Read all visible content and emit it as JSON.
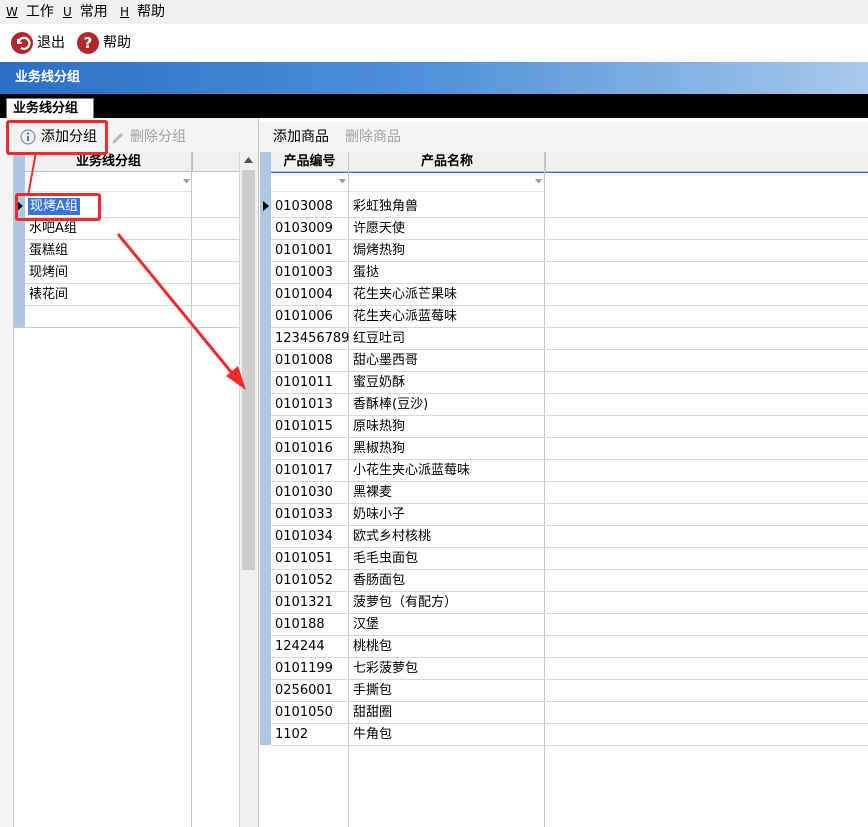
{
  "menubar": {
    "items": [
      {
        "accel": "W",
        "label": "工作"
      },
      {
        "accel": "U",
        "label": "常用"
      },
      {
        "accel": "H",
        "label": "帮助"
      }
    ]
  },
  "toolbar": {
    "exit_label": "退出",
    "help_label": "帮助"
  },
  "header": {
    "title": "业务线分组"
  },
  "tabs": [
    {
      "label": "业务线分组",
      "active": true
    }
  ],
  "left": {
    "add_group_label": "添加分组",
    "delete_group_label": "删除分组",
    "column_header": "业务线分组",
    "groups": [
      "现烤A组",
      "水吧A组",
      "蛋糕组",
      "现烤间",
      "裱花间"
    ],
    "selected_index": 0
  },
  "right": {
    "add_product_label": "添加商品",
    "delete_product_label": "删除商品",
    "col_code": "产品编号",
    "col_name": "产品名称",
    "products": [
      {
        "code": "0103008",
        "name": "彩虹独角兽"
      },
      {
        "code": "0103009",
        "name": "许愿天使"
      },
      {
        "code": "0101001",
        "name": "焗烤热狗"
      },
      {
        "code": "0101003",
        "name": "蛋挞"
      },
      {
        "code": "0101004",
        "name": "花生夹心派芒果味"
      },
      {
        "code": "0101006",
        "name": "花生夹心派蓝莓味"
      },
      {
        "code": "123456789",
        "name": "红豆吐司"
      },
      {
        "code": "0101008",
        "name": "甜心墨西哥"
      },
      {
        "code": "0101011",
        "name": "蜜豆奶酥"
      },
      {
        "code": "0101013",
        "name": "香酥棒(豆沙)"
      },
      {
        "code": "0101015",
        "name": "原味热狗"
      },
      {
        "code": "0101016",
        "name": "黑椒热狗"
      },
      {
        "code": "0101017",
        "name": "小花生夹心派蓝莓味"
      },
      {
        "code": "0101030",
        "name": "黑裸麦"
      },
      {
        "code": "0101033",
        "name": "奶味小子"
      },
      {
        "code": "0101034",
        "name": "欧式乡村核桃"
      },
      {
        "code": "0101051",
        "name": "毛毛虫面包"
      },
      {
        "code": "0101052",
        "name": "香肠面包"
      },
      {
        "code": "0101321",
        "name": "菠萝包（有配方）"
      },
      {
        "code": "010188",
        "name": "汉堡"
      },
      {
        "code": "124244",
        "name": "桃桃包"
      },
      {
        "code": "0101199",
        "name": "七彩菠萝包"
      },
      {
        "code": "0256001",
        "name": "手撕包"
      },
      {
        "code": "0101050",
        "name": "甜甜圈"
      },
      {
        "code": "1102",
        "name": "牛角包"
      }
    ]
  },
  "colors": {
    "annotation_red": "#f02b2b",
    "selection_blue": "#3875d7",
    "header_blue": "#2a6fc6",
    "exit_icon_red": "#b0282c"
  },
  "icons": {
    "exit": "exit-icon",
    "help": "help-icon",
    "add_group": "info-icon",
    "delete_group": "pencil-icon"
  }
}
